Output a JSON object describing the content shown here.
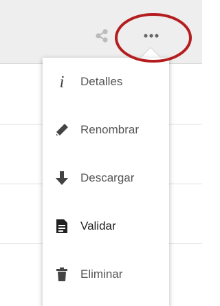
{
  "toolbar": {
    "share_icon": "share-icon",
    "more_icon": "more-options-icon",
    "more_glyph": "•••"
  },
  "menu": {
    "items": [
      {
        "label": "Detalles",
        "icon": "info-icon",
        "glyph": "i"
      },
      {
        "label": "Renombrar",
        "icon": "pencil-icon"
      },
      {
        "label": "Descargar",
        "icon": "arrow-down-icon"
      },
      {
        "label": "Validar",
        "icon": "document-icon",
        "active": true
      },
      {
        "label": "Eliminar",
        "icon": "trash-icon"
      }
    ]
  },
  "colors": {
    "annotation_circle": "#b41e1e",
    "toolbar_bg": "#eeeeee",
    "icon_gray": "#bbbbbb",
    "menu_text": "#555555",
    "active_text": "#222222"
  }
}
